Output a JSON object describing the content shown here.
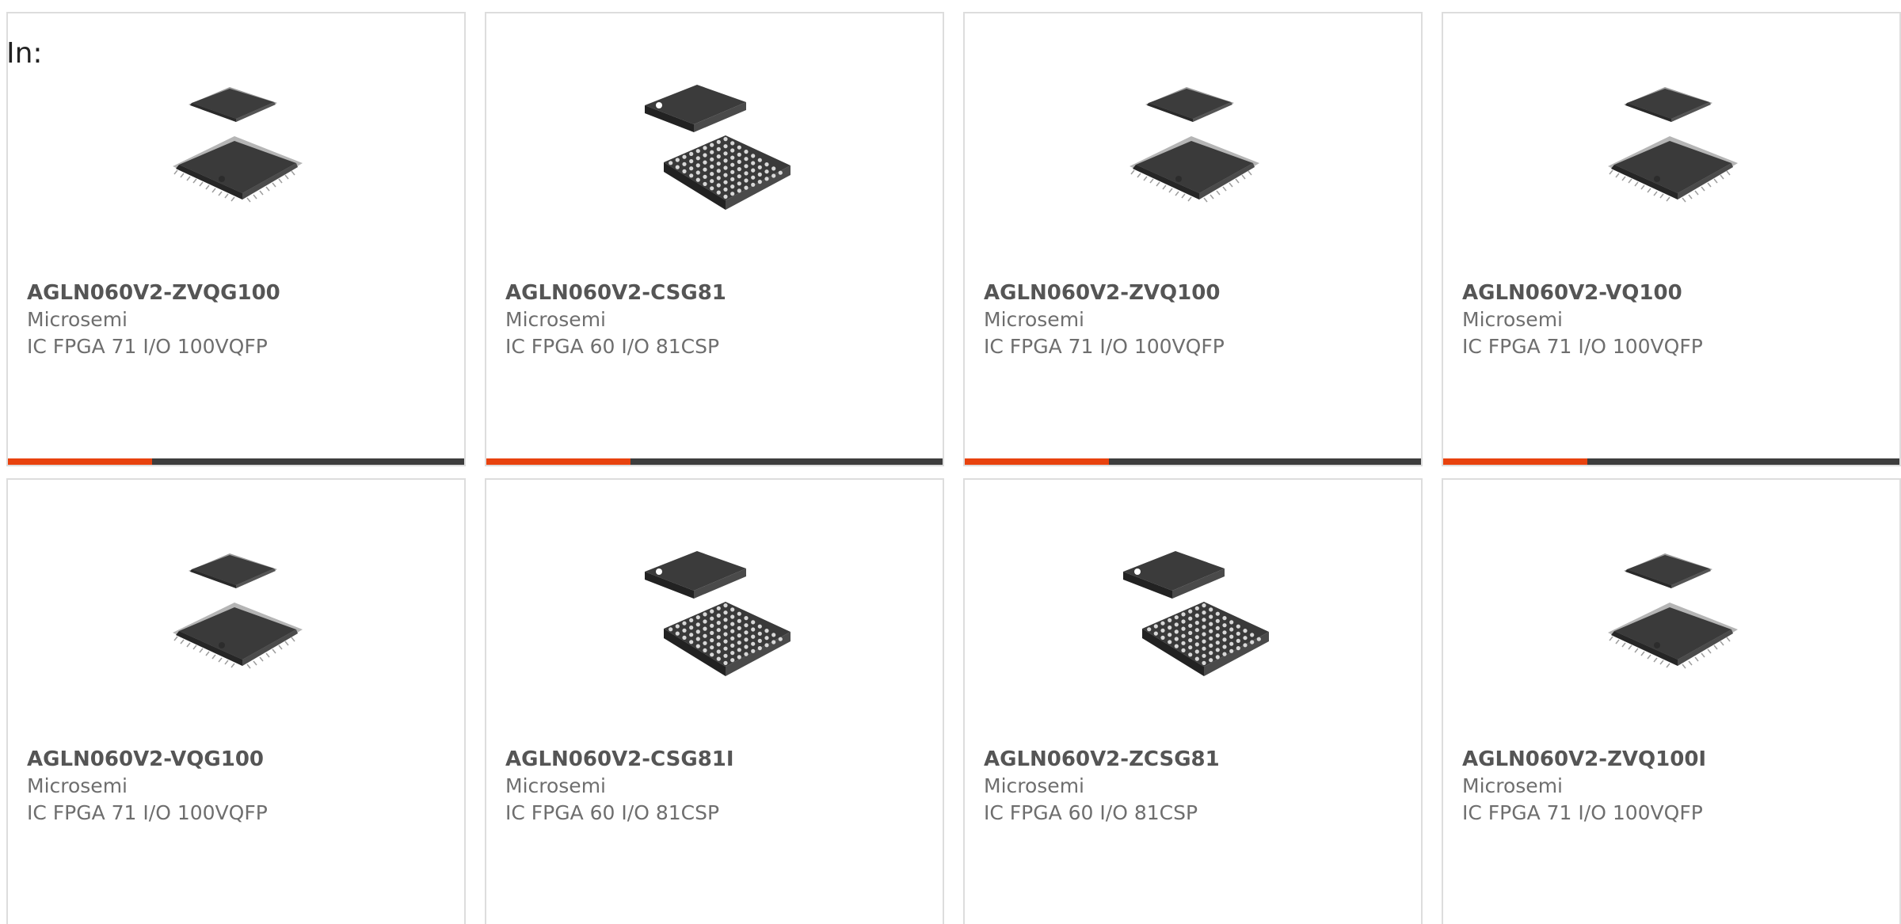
{
  "filter_label": "In:",
  "colors": {
    "accent": "#e8420e",
    "bar_dark": "#3d3d3d",
    "border": "#dddddd"
  },
  "products": [
    {
      "part": "AGLN060V2-ZVQG100",
      "manufacturer": "Microsemi",
      "description": "IC FPGA 71 I/O 100VQFP",
      "image": "qfp-chip-icon",
      "show_bar": true
    },
    {
      "part": "AGLN060V2-CSG81",
      "manufacturer": "Microsemi",
      "description": "IC FPGA 60 I/O 81CSP",
      "image": "bga-chip-icon",
      "show_bar": true
    },
    {
      "part": "AGLN060V2-ZVQ100",
      "manufacturer": "Microsemi",
      "description": "IC FPGA 71 I/O 100VQFP",
      "image": "qfp-chip-icon",
      "show_bar": true
    },
    {
      "part": "AGLN060V2-VQ100",
      "manufacturer": "Microsemi",
      "description": "IC FPGA 71 I/O 100VQFP",
      "image": "qfp-chip-icon",
      "show_bar": true
    },
    {
      "part": "AGLN060V2-VQG100",
      "manufacturer": "Microsemi",
      "description": "IC FPGA 71 I/O 100VQFP",
      "image": "qfp-chip-icon",
      "show_bar": false
    },
    {
      "part": "AGLN060V2-CSG81I",
      "manufacturer": "Microsemi",
      "description": "IC FPGA 60 I/O 81CSP",
      "image": "bga-chip-icon",
      "show_bar": false
    },
    {
      "part": "AGLN060V2-ZCSG81",
      "manufacturer": "Microsemi",
      "description": "IC FPGA 60 I/O 81CSP",
      "image": "bga-chip-icon",
      "show_bar": false
    },
    {
      "part": "AGLN060V2-ZVQ100I",
      "manufacturer": "Microsemi",
      "description": "IC FPGA 71 I/O 100VQFP",
      "image": "qfp-chip-icon",
      "show_bar": false
    }
  ]
}
